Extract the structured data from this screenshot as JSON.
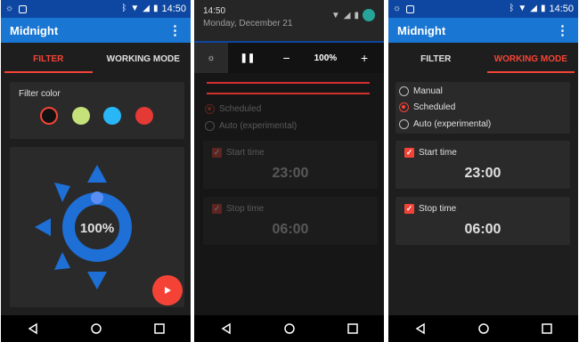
{
  "status": {
    "time": "14:50"
  },
  "app": {
    "title": "Midnight"
  },
  "tabs": [
    {
      "label": "FILTER"
    },
    {
      "label": "WORKING MODE"
    }
  ],
  "filter": {
    "color_label": "Filter color",
    "swatches": [
      "#111111",
      "#c5e17a",
      "#29b6f6",
      "#e53935"
    ],
    "intensity_label": "100%"
  },
  "shade": {
    "time": "14:50",
    "date": "Monday, December 21",
    "percent": "100%",
    "minus": "−",
    "plus": "+"
  },
  "working_mode": {
    "options": [
      {
        "label": "Manual"
      },
      {
        "label": "Scheduled"
      },
      {
        "label": "Auto (experimental)"
      }
    ],
    "selected": 1,
    "start_label": "Start time",
    "start_value": "23:00",
    "stop_label": "Stop time",
    "stop_value": "06:00"
  },
  "colors": {
    "primary": "#1976d2",
    "primary_dark": "#0d47a1",
    "accent": "#f44336",
    "wheel": "#1e6fd6"
  },
  "icons": [
    "bluetooth-icon",
    "wifi-icon",
    "signal-icon",
    "battery-icon",
    "overflow-menu-icon",
    "play-icon",
    "brightness-icon",
    "pause-icon",
    "back-icon",
    "home-icon",
    "recents-icon"
  ]
}
